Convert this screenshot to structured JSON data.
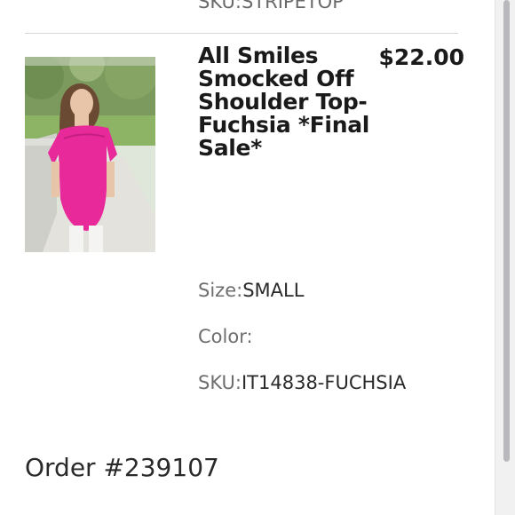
{
  "previous_item": {
    "sku_label": "SKU:",
    "sku_value": "STRIPETOP"
  },
  "item": {
    "image_icon": "product-photo",
    "title": "All Smiles Smocked Off Shoulder Top-Fuchsia *Final Sale*",
    "price": "$22.00",
    "size_label": "Size:",
    "size_value": "SMALL",
    "color_label": "Color:",
    "color_value": "",
    "sku_label": "SKU:",
    "sku_value": "IT14838-FUCHSIA"
  },
  "order": {
    "number": "Order #239107"
  },
  "colors": {
    "accent_product": "#e8299a",
    "text_primary": "#1a1a1a",
    "text_muted": "#6e6e6e",
    "divider": "#d6d6d6"
  }
}
